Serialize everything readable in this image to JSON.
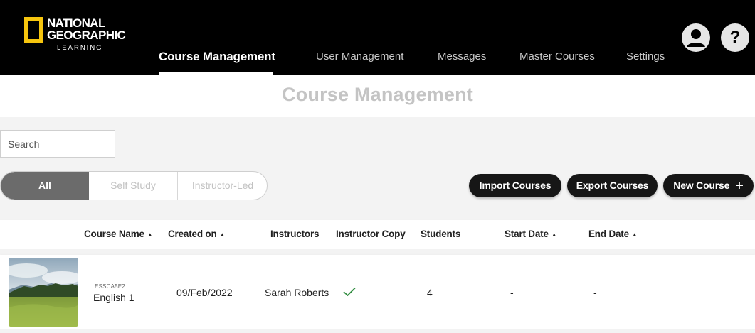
{
  "brand": {
    "line1": "NATIONAL",
    "line2": "GEOGRAPHIC",
    "line3": "LEARNING",
    "accent_color": "#f6c50e"
  },
  "nav": {
    "items": [
      {
        "label": "Course Management",
        "active": true
      },
      {
        "label": "User Management"
      },
      {
        "label": "Messages"
      },
      {
        "label": "Master Courses"
      },
      {
        "label": "Settings"
      }
    ],
    "profile_icon": "user-circle-icon",
    "help_icon": "question-mark-icon",
    "help_glyph": "?"
  },
  "page": {
    "title": "Course Management"
  },
  "search": {
    "placeholder": "Search",
    "value": ""
  },
  "filters": {
    "selected": "All",
    "options": [
      "All",
      "Self Study",
      "Instructor-Led"
    ]
  },
  "actions": {
    "import_label": "Import Courses",
    "export_label": "Export Courses",
    "new_label": "New Course",
    "new_icon": "+"
  },
  "table": {
    "columns": [
      {
        "label": "Course Name",
        "sortable": true
      },
      {
        "label": "Created on",
        "sortable": true
      },
      {
        "label": "Instructors",
        "sortable": false
      },
      {
        "label": "Instructor Copy",
        "sortable": false
      },
      {
        "label": "Students",
        "sortable": false
      },
      {
        "label": "Start Date",
        "sortable": true
      },
      {
        "label": "End Date",
        "sortable": true
      }
    ],
    "sort_glyph": "▲",
    "rows": [
      {
        "code": "ESSCA5E2",
        "name": "English 1",
        "created_on": "09/Feb/2022",
        "instructors": "Sarah Roberts",
        "instructor_copy": true,
        "students": "4",
        "start_date": "-",
        "end_date": "-"
      }
    ]
  },
  "colors": {
    "header_bg": "#000000",
    "panel_bg": "#f3f3f3",
    "button_bg": "#161616",
    "filter_active_bg": "#6b6b6b",
    "check_color": "#2e8b3e"
  }
}
